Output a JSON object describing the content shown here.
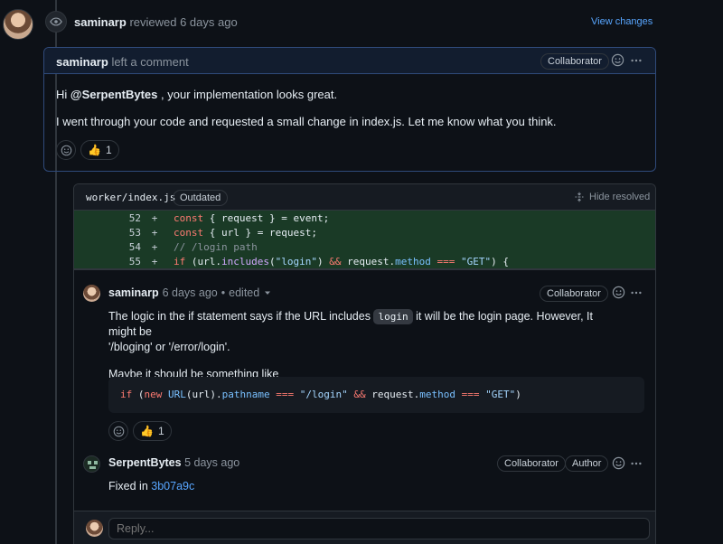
{
  "review": {
    "author": "saminarp",
    "action": "reviewed 6 days ago",
    "view_changes": "View changes"
  },
  "top_comment": {
    "author": "saminarp",
    "action": "left a comment",
    "badge": "Collaborator",
    "line1_prefix": "Hi",
    "line1_mention": "@SerpentBytes",
    "line1_suffix": ", your implementation looks great.",
    "line2": "I went through your code and requested a small change in index.js. Let me know what you think.",
    "reaction_count": "1"
  },
  "file": {
    "path": "worker/index.js",
    "status_badge": "Outdated",
    "hide_resolved": "Hide resolved",
    "lines": [
      {
        "num": "52",
        "sign": "+"
      },
      {
        "num": "53",
        "sign": "+"
      },
      {
        "num": "54",
        "sign": "+"
      },
      {
        "num": "55",
        "sign": "+"
      }
    ]
  },
  "thread_comment_1": {
    "author": "saminarp",
    "time": "6 days ago",
    "separator": "•",
    "edited": "edited",
    "badge": "Collaborator",
    "para1_a": "The logic in the if statement says if the URL includes",
    "para1_code": "login",
    "para1_b": "it will be the login page. However, It might be",
    "para1_c": "'/bloging' or '/error/login'.",
    "para2": "Maybe it should be something like",
    "reaction_count": "1"
  },
  "thread_comment_2": {
    "author": "SerpentBytes",
    "time": "5 days ago",
    "badge_collab": "Collaborator",
    "badge_author": "Author",
    "fixed_prefix": "Fixed in",
    "commit": "3b07a9c"
  },
  "reply": {
    "placeholder": "Reply..."
  },
  "colors": {
    "background": "#0d1117",
    "added_line_bg": "#1a3a26",
    "link": "#58a6ff",
    "border": "#30363d"
  }
}
